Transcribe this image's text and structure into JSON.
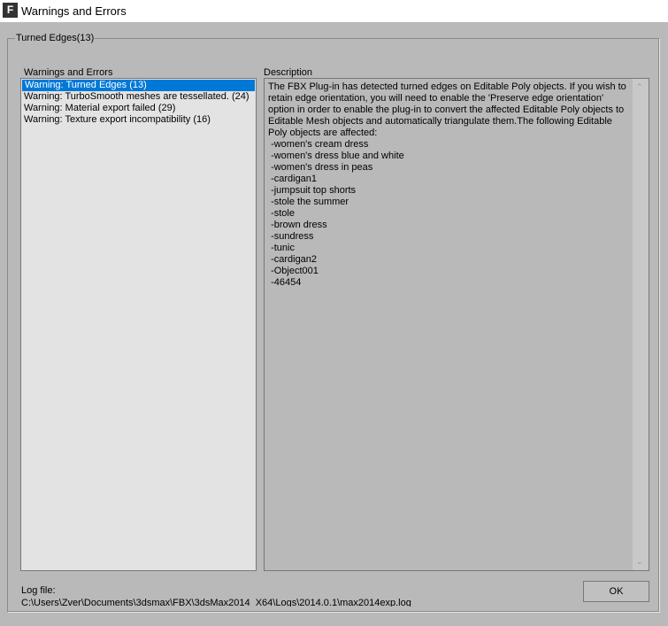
{
  "window": {
    "title": "Warnings and Errors"
  },
  "group": {
    "label": "Turned Edges(13)"
  },
  "list": {
    "header": "Warnings and Errors",
    "items": [
      "Warning: Turned Edges (13)",
      "Warning: TurboSmooth meshes are tessellated. (24)",
      "Warning: Material export failed (29)",
      "Warning: Texture export incompatibility (16)"
    ]
  },
  "description": {
    "header": "Description",
    "text": "The FBX Plug-in has detected turned edges on Editable Poly objects. If you wish to retain edge orientation, you will need to enable the 'Preserve edge orientation' option in order to enable the plug-in to convert the affected Editable Poly objects to Editable Mesh objects and automatically triangulate them.The following Editable Poly objects are affected:\n -women's cream dress\n -women's dress blue and white\n -women's dress in peas\n -cardigan1\n -jumpsuit top shorts\n -stole the summer\n -stole\n -brown dress\n -sundress\n -tunic\n -cardigan2\n -Object001\n -46454"
  },
  "log": {
    "label": "Log file:",
    "path": "C:\\Users\\Zver\\Documents\\3dsmax\\FBX\\3dsMax2014_X64\\Logs\\2014.0.1\\max2014exp.log"
  },
  "ok_label": "OK"
}
